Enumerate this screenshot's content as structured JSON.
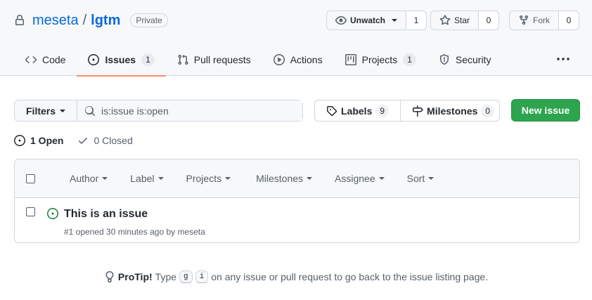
{
  "repo": {
    "owner": "meseta",
    "separator": "/",
    "name": "lgtm",
    "visibility": "Private"
  },
  "actions": {
    "watch": {
      "label": "Unwatch",
      "count": "1"
    },
    "star": {
      "label": "Star",
      "count": "0"
    },
    "fork": {
      "label": "Fork",
      "count": "0"
    }
  },
  "tabs": [
    {
      "label": "Code",
      "icon": "code-icon"
    },
    {
      "label": "Issues",
      "icon": "issue-opened-icon",
      "counter": "1",
      "active": true
    },
    {
      "label": "Pull requests",
      "icon": "git-pull-request-icon"
    },
    {
      "label": "Actions",
      "icon": "play-icon"
    },
    {
      "label": "Projects",
      "icon": "project-icon",
      "counter": "1"
    },
    {
      "label": "Security",
      "icon": "shield-icon"
    }
  ],
  "filters": {
    "label": "Filters",
    "search_value": "is:issue is:open"
  },
  "labels": {
    "label": "Labels",
    "count": "9"
  },
  "milestones": {
    "label": "Milestones",
    "count": "0"
  },
  "new_issue": "New issue",
  "states": {
    "open": "1 Open",
    "closed": "0 Closed"
  },
  "sort_menus": [
    "Author",
    "Label",
    "Projects",
    "Milestones",
    "Assignee",
    "Sort"
  ],
  "issues": [
    {
      "title": "This is an issue",
      "meta": "#1 opened 30 minutes ago by meseta"
    }
  ],
  "protip": {
    "lead": "ProTip!",
    "text_before": "Type",
    "key1": "g",
    "key2": "i",
    "text_after": "on any issue or pull request to go back to the issue listing page."
  },
  "colors": {
    "accent": "#0969da",
    "primary_button": "#2da44e",
    "open_state": "#1a7f37",
    "active_tab_underline": "#fd8c73"
  }
}
